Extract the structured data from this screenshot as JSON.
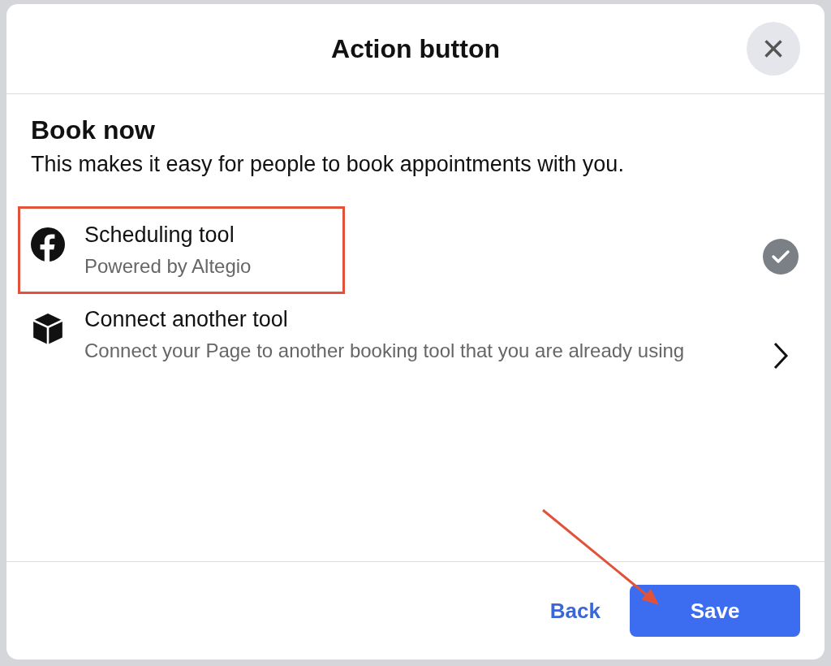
{
  "dialog": {
    "title": "Action button",
    "close_icon": "×"
  },
  "section": {
    "title": "Book now",
    "description": "This makes it easy for people to book appointments with you."
  },
  "options": [
    {
      "kind": "option",
      "title": "Scheduling tool",
      "subtitle": "Powered by Altegio",
      "selected": true
    },
    {
      "kind": "link",
      "title": "Connect another tool",
      "subtitle": "Connect your Page to another booking tool that you are already using",
      "selected": false
    }
  ],
  "footer": {
    "back": "Back",
    "save": "Save"
  }
}
